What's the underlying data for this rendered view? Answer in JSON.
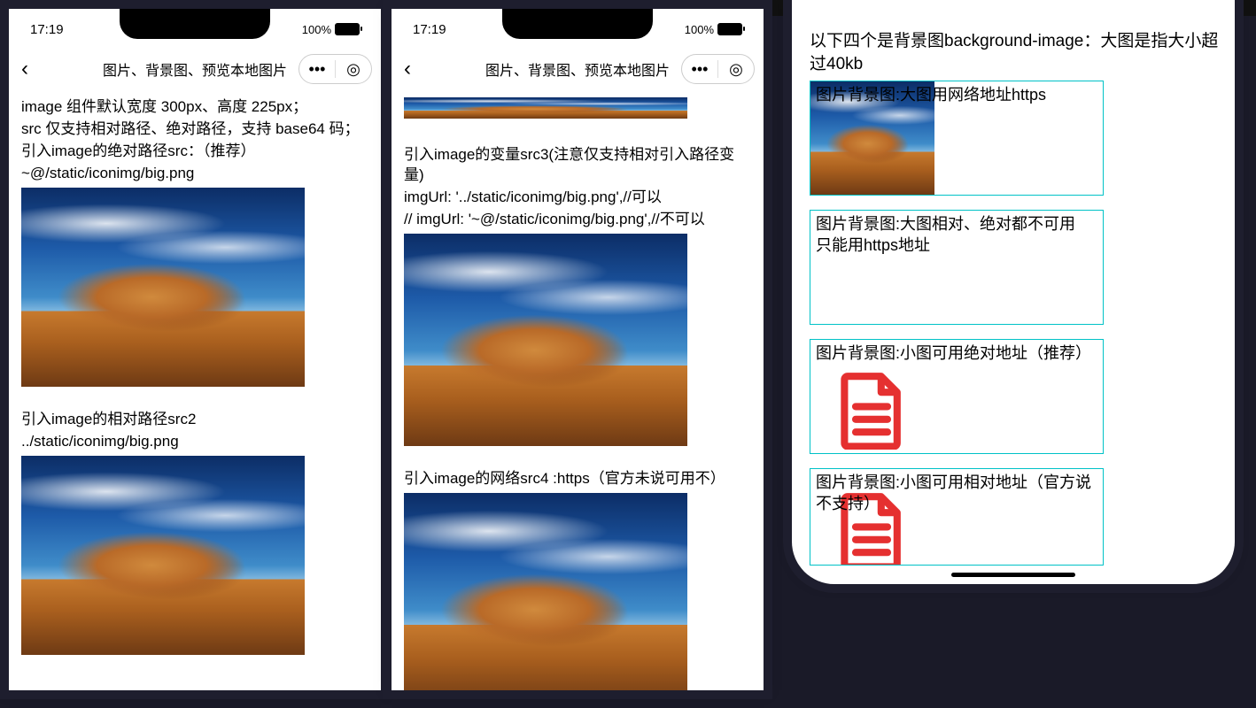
{
  "status": {
    "time": "17:19",
    "battery_pct": "100%"
  },
  "nav": {
    "title": "图片、背景图、预览本地图片"
  },
  "phone1": {
    "p1": "image 组件默认宽度 300px、高度 225px；",
    "p2": "src 仅支持相对路径、绝对路径，支持 base64 码；",
    "p3": "引入image的绝对路径src：（推荐）",
    "p4": "~@/static/iconimg/big.png",
    "p5": "引入image的相对路径src2",
    "p6": "../static/iconimg/big.png"
  },
  "phone2": {
    "p1": "引入image的变量src3(注意仅支持相对引入路径变量)",
    "p2": "imgUrl: '../static/iconimg/big.png',//可以",
    "p3": "// imgUrl: '~@/static/iconimg/big.png',//不可以",
    "p4": "引入image的网络src4 :https（官方未说可用不）"
  },
  "phone3": {
    "intro": "以下四个是背景图background-image：大图是指大小超过40kb",
    "box1": "图片背景图:大图用网络地址https",
    "box2a": "图片背景图:大图相对、绝对都不可用",
    "box2b": "只能用https地址",
    "box3": "图片背景图:小图可用绝对地址（推荐）",
    "box4": "图片背景图:小图可用相对地址（官方说不支持）"
  },
  "icons": {
    "back": "‹",
    "more": "•••",
    "target": "◎"
  }
}
